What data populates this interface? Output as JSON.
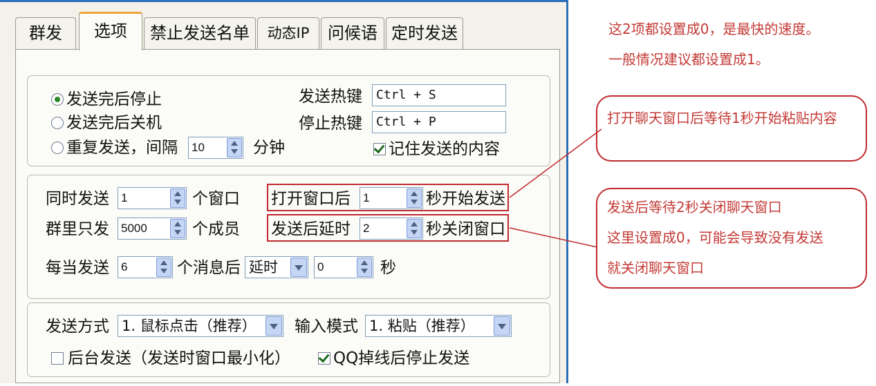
{
  "tabs": [
    "群发",
    "选项",
    "禁止发送名单",
    "动态IP",
    "问候语",
    "定时发送"
  ],
  "send_mode": {
    "options": [
      "发送完后停止",
      "发送完后关机",
      "重复发送，间隔"
    ],
    "selected": "发送完后停止",
    "repeat_interval": "10",
    "minutes_unit": "分钟"
  },
  "hotkeys": {
    "send_label": "发送热键",
    "send_value": "Ctrl + S",
    "stop_label": "停止热键",
    "stop_value": "Ctrl + P",
    "remember_label": "记住发送的内容",
    "remember_checked": true
  },
  "timing": {
    "simul_label": "同时发送",
    "simul_value": "1",
    "simul_unit": "个窗口",
    "group_label": "群里只发",
    "group_value": "5000",
    "group_unit": "个成员",
    "every_label": "每当发送",
    "every_value": "6",
    "every_unit": "个消息后",
    "delay_mode": "延时",
    "delay_value": "0",
    "delay_unit": "秒",
    "open_label": "打开窗口后",
    "open_value": "1",
    "open_unit": "秒开始发送",
    "after_label": "发送后延时",
    "after_value": "2",
    "after_unit": "秒关闭窗口"
  },
  "method": {
    "send_label": "发送方式",
    "send_value": "1. 鼠标点击（推荐）",
    "input_label": "输入模式",
    "input_value": "1. 粘贴（推荐）",
    "background_label": "后台发送（发送时窗口最小化）",
    "background_checked": false,
    "qq_label": "QQ掉线后停止发送",
    "qq_checked": true
  },
  "notes": {
    "top_line1": "这2项都设置成0，是最快的速度。",
    "top_line2": "一般情况建议都设置成1。",
    "bubble1": "打开聊天窗口后等待1秒开始粘贴内容",
    "bubble2_line1": "发送后等待2秒关闭聊天窗口",
    "bubble2_line2": "这里设置成0，可能会导致没有发送",
    "bubble2_line3": "就关闭聊天窗口"
  },
  "colors": {
    "annotation_red": "#c0282d",
    "active_tab_accent": "#f0a23b",
    "window_border": "#2b6fb8"
  }
}
